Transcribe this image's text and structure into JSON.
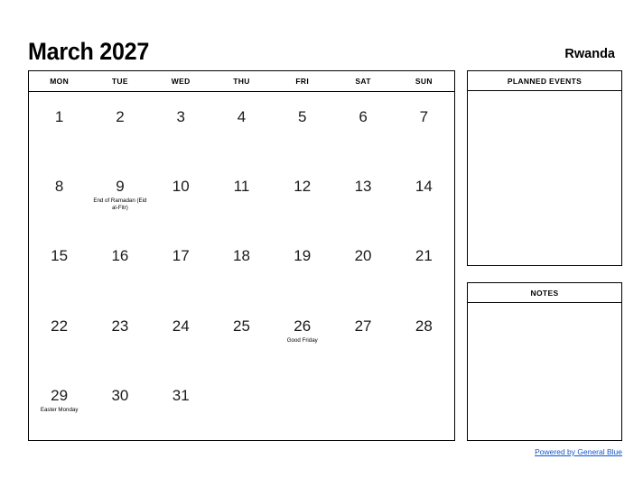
{
  "header": {
    "title": "March 2027",
    "country": "Rwanda"
  },
  "calendar": {
    "weekdays": [
      "MON",
      "TUE",
      "WED",
      "THU",
      "FRI",
      "SAT",
      "SUN"
    ],
    "weeks": [
      [
        {
          "day": "1",
          "events": []
        },
        {
          "day": "2",
          "events": []
        },
        {
          "day": "3",
          "events": []
        },
        {
          "day": "4",
          "events": []
        },
        {
          "day": "5",
          "events": []
        },
        {
          "day": "6",
          "events": []
        },
        {
          "day": "7",
          "events": []
        }
      ],
      [
        {
          "day": "8",
          "events": []
        },
        {
          "day": "9",
          "events": [
            "End of Ramadan (Eid al-Fitr)"
          ]
        },
        {
          "day": "10",
          "events": []
        },
        {
          "day": "11",
          "events": []
        },
        {
          "day": "12",
          "events": []
        },
        {
          "day": "13",
          "events": []
        },
        {
          "day": "14",
          "events": []
        }
      ],
      [
        {
          "day": "15",
          "events": []
        },
        {
          "day": "16",
          "events": []
        },
        {
          "day": "17",
          "events": []
        },
        {
          "day": "18",
          "events": []
        },
        {
          "day": "19",
          "events": []
        },
        {
          "day": "20",
          "events": []
        },
        {
          "day": "21",
          "events": []
        }
      ],
      [
        {
          "day": "22",
          "events": []
        },
        {
          "day": "23",
          "events": []
        },
        {
          "day": "24",
          "events": []
        },
        {
          "day": "25",
          "events": []
        },
        {
          "day": "26",
          "events": [
            "Good Friday"
          ]
        },
        {
          "day": "27",
          "events": []
        },
        {
          "day": "28",
          "events": []
        }
      ],
      [
        {
          "day": "29",
          "events": [
            "Easter Monday"
          ]
        },
        {
          "day": "30",
          "events": []
        },
        {
          "day": "31",
          "events": []
        },
        {
          "day": "",
          "events": []
        },
        {
          "day": "",
          "events": []
        },
        {
          "day": "",
          "events": []
        },
        {
          "day": "",
          "events": []
        }
      ]
    ]
  },
  "panels": {
    "planned_events": {
      "title": "PLANNED EVENTS",
      "body": ""
    },
    "notes": {
      "title": "NOTES",
      "body": ""
    }
  },
  "footer": {
    "link_text": "Powered by General Blue",
    "link_color": "#1155cc"
  }
}
